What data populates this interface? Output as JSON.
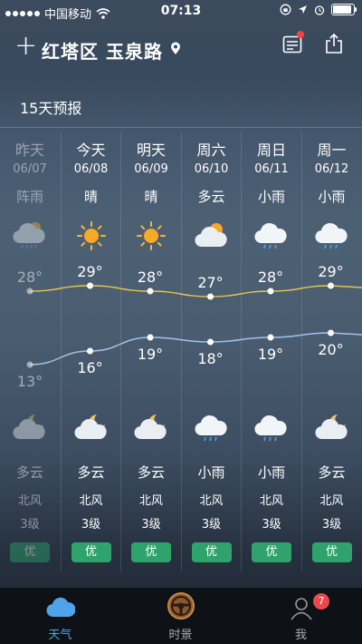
{
  "status": {
    "carrier": "中国移动",
    "time": "07:13"
  },
  "header": {
    "location": "红塔区 玉泉路"
  },
  "forecast_title": "15天预报",
  "days": [
    {
      "name": "昨天",
      "date": "06/07",
      "day_cond": "阵雨",
      "day_icon": "shower-rain-icon",
      "high": "28°",
      "high_val": 28,
      "low": "13°",
      "low_val": 13,
      "night_cond": "多云",
      "night_icon": "partly-cloudy-night-icon",
      "wind_dir": "北风",
      "wind_level": "3级",
      "aqi": "优"
    },
    {
      "name": "今天",
      "date": "06/08",
      "day_cond": "晴",
      "day_icon": "sunny-icon",
      "high": "29°",
      "high_val": 29,
      "low": "16°",
      "low_val": 16,
      "night_cond": "多云",
      "night_icon": "partly-cloudy-night-icon",
      "wind_dir": "北风",
      "wind_level": "3级",
      "aqi": "优"
    },
    {
      "name": "明天",
      "date": "06/09",
      "day_cond": "晴",
      "day_icon": "sunny-icon",
      "high": "28°",
      "high_val": 28,
      "low": "19°",
      "low_val": 19,
      "night_cond": "多云",
      "night_icon": "partly-cloudy-night-icon",
      "wind_dir": "北风",
      "wind_level": "3级",
      "aqi": "优"
    },
    {
      "name": "周六",
      "date": "06/10",
      "day_cond": "多云",
      "day_icon": "partly-cloudy-icon",
      "high": "27°",
      "high_val": 27,
      "low": "18°",
      "low_val": 18,
      "night_cond": "小雨",
      "night_icon": "light-rain-icon",
      "wind_dir": "北风",
      "wind_level": "3级",
      "aqi": "优"
    },
    {
      "name": "周日",
      "date": "06/11",
      "day_cond": "小雨",
      "day_icon": "light-rain-icon",
      "high": "28°",
      "high_val": 28,
      "low": "19°",
      "low_val": 19,
      "night_cond": "小雨",
      "night_icon": "light-rain-icon",
      "wind_dir": "北风",
      "wind_level": "3级",
      "aqi": "优"
    },
    {
      "name": "周一",
      "date": "06/12",
      "day_cond": "小雨",
      "day_icon": "light-rain-icon",
      "high": "29°",
      "high_val": 29,
      "low": "20°",
      "low_val": 20,
      "night_cond": "多云",
      "night_icon": "partly-cloudy-night-icon",
      "wind_dir": "北风",
      "wind_level": "3级",
      "aqi": "优"
    }
  ],
  "colors": {
    "high_line": "#e8c547",
    "low_line": "#9fc4e6",
    "aqi_good": "#2ea46c",
    "accent": "#4fa3e8"
  },
  "tabs": [
    {
      "label": "天气",
      "icon": "cloud-icon",
      "active": true
    },
    {
      "label": "时景",
      "icon": "steering-wheel-icon",
      "active": false
    },
    {
      "label": "我",
      "icon": "user-icon",
      "active": false,
      "badge": "7"
    }
  ]
}
